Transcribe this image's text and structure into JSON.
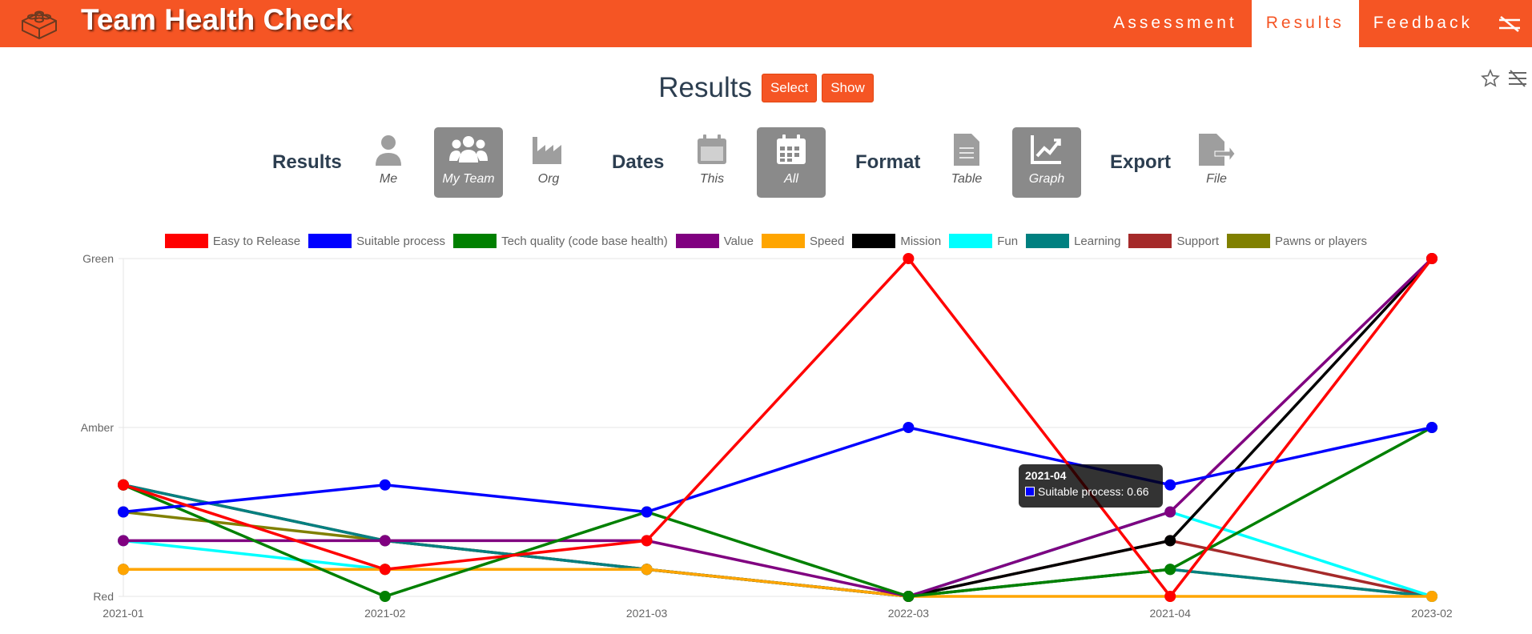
{
  "app": {
    "title": "Team Health Check"
  },
  "nav": {
    "items": [
      "Assessment",
      "Results",
      "Feedback"
    ],
    "active": 1
  },
  "header": {
    "title": "Results",
    "select_label": "Select",
    "show_label": "Show"
  },
  "controls": {
    "results_label": "Results",
    "results_options": [
      "Me",
      "My Team",
      "Org"
    ],
    "dates_label": "Dates",
    "dates_options": [
      "This",
      "All"
    ],
    "format_label": "Format",
    "format_options": [
      "Table",
      "Graph"
    ],
    "export_label": "Export",
    "export_options": [
      "File"
    ]
  },
  "colors": {
    "accent": "#f55524",
    "selected": "#8a8a8a"
  },
  "tooltip": {
    "title": "2021-04",
    "series": "Suitable process",
    "value": "Suitable process: 0.66",
    "color": "#0000ff"
  },
  "chart_data": {
    "type": "line",
    "categories": [
      "2021-01",
      "2021-02",
      "2021-03",
      "2022-03",
      "2021-04",
      "2023-02"
    ],
    "y_tick_labels": [
      "Red",
      "Amber",
      "Green"
    ],
    "ylim": [
      0,
      2
    ],
    "legend_position": "top",
    "grid": true,
    "series": [
      {
        "name": "Easy to Release",
        "color": "#ff0000",
        "values": [
          0.66,
          0.16,
          0.33,
          2.0,
          0.0,
          2.0
        ]
      },
      {
        "name": "Suitable process",
        "color": "#0000ff",
        "values": [
          0.5,
          0.66,
          0.5,
          1.0,
          0.66,
          1.0
        ]
      },
      {
        "name": "Tech quality (code base health)",
        "color": "#008000",
        "values": [
          0.66,
          0.0,
          0.5,
          0.0,
          0.16,
          1.0
        ]
      },
      {
        "name": "Value",
        "color": "#800080",
        "values": [
          0.33,
          0.33,
          0.33,
          0.0,
          0.5,
          2.0
        ]
      },
      {
        "name": "Speed",
        "color": "#ffa500",
        "values": [
          0.16,
          0.16,
          0.16,
          0.0,
          0.0,
          0.0
        ]
      },
      {
        "name": "Mission",
        "color": "#000000",
        "values": [
          0.16,
          0.16,
          0.16,
          0.0,
          0.33,
          2.0
        ]
      },
      {
        "name": "Fun",
        "color": "#00ffff",
        "values": [
          0.33,
          0.16,
          0.16,
          0.0,
          0.5,
          0.0
        ]
      },
      {
        "name": "Learning",
        "color": "#008080",
        "values": [
          0.66,
          0.33,
          0.16,
          0.0,
          0.16,
          0.0
        ]
      },
      {
        "name": "Support",
        "color": "#a52a2a",
        "values": [
          0.66,
          0.33,
          0.16,
          0.0,
          0.33,
          0.0
        ]
      },
      {
        "name": "Pawns or players",
        "color": "#808000",
        "values": [
          0.5,
          0.33,
          0.16,
          0.0,
          0.16,
          0.0
        ]
      }
    ]
  }
}
